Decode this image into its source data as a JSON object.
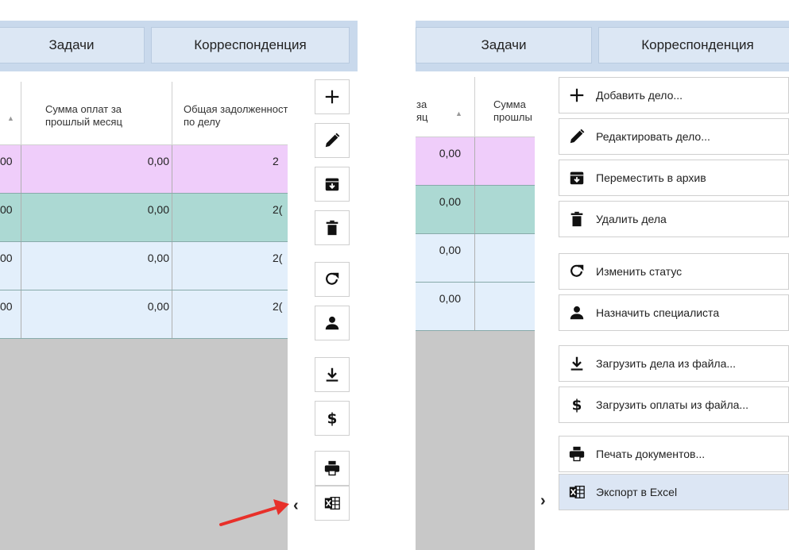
{
  "tabs": {
    "tasks": "Задачи",
    "correspondence": "Корреспонденция"
  },
  "left_table": {
    "headers": {
      "partial": "",
      "payments_last_month": "Сумма оплат за\nпрошлый месяц",
      "total_debt": "Общая задолженность\nпо делу"
    },
    "rows": [
      {
        "partial": "00",
        "payments": "0,00",
        "debt": "2",
        "color": "#efcdfa"
      },
      {
        "partial": "00",
        "payments": "0,00",
        "debt": "2(",
        "color": "#acd9d3"
      },
      {
        "partial": "00",
        "payments": "0,00",
        "debt": "2(",
        "color": "#e3effb"
      },
      {
        "partial": "00",
        "payments": "0,00",
        "debt": "2(",
        "color": "#e3effb"
      }
    ]
  },
  "toolbar_icons": [
    "plus-icon",
    "pencil-icon",
    "archive-icon",
    "trash-icon",
    "refresh-icon",
    "person-icon",
    "download-icon",
    "dollar-icon",
    "printer-icon",
    "excel-icon"
  ],
  "collapse_chevron": "‹",
  "expand_chevron": "›",
  "right_table": {
    "headers": {
      "partial1": "за\nяц",
      "partial2": "Сумма\nпрошлы"
    },
    "rows": [
      {
        "value": "0,00",
        "color": "#efcdfa"
      },
      {
        "value": "0,00",
        "color": "#acd9d3"
      },
      {
        "value": "0,00",
        "color": "#e3effb"
      },
      {
        "value": "0,00",
        "color": "#e3effb"
      }
    ]
  },
  "menu": {
    "items": [
      {
        "icon": "plus-icon",
        "label": "Добавить дело..."
      },
      {
        "icon": "pencil-icon",
        "label": "Редактировать дело..."
      },
      {
        "icon": "archive-icon",
        "label": "Переместить в архив"
      },
      {
        "icon": "trash-icon",
        "label": "Удалить дела"
      },
      {
        "icon": "refresh-icon",
        "label": "Изменить статус"
      },
      {
        "icon": "person-icon",
        "label": "Назначить специалиста"
      },
      {
        "icon": "download-icon",
        "label": "Загрузить дела из файла..."
      },
      {
        "icon": "dollar-icon",
        "label": "Загрузить оплаты из файла..."
      },
      {
        "icon": "printer-icon",
        "label": "Печать документов..."
      },
      {
        "icon": "excel-icon",
        "label": "Экспорт в Excel"
      }
    ]
  },
  "colors": {
    "arrow": "#e8302a",
    "highlight": "#dce6f4",
    "tabbar": "#c9d9ec"
  }
}
